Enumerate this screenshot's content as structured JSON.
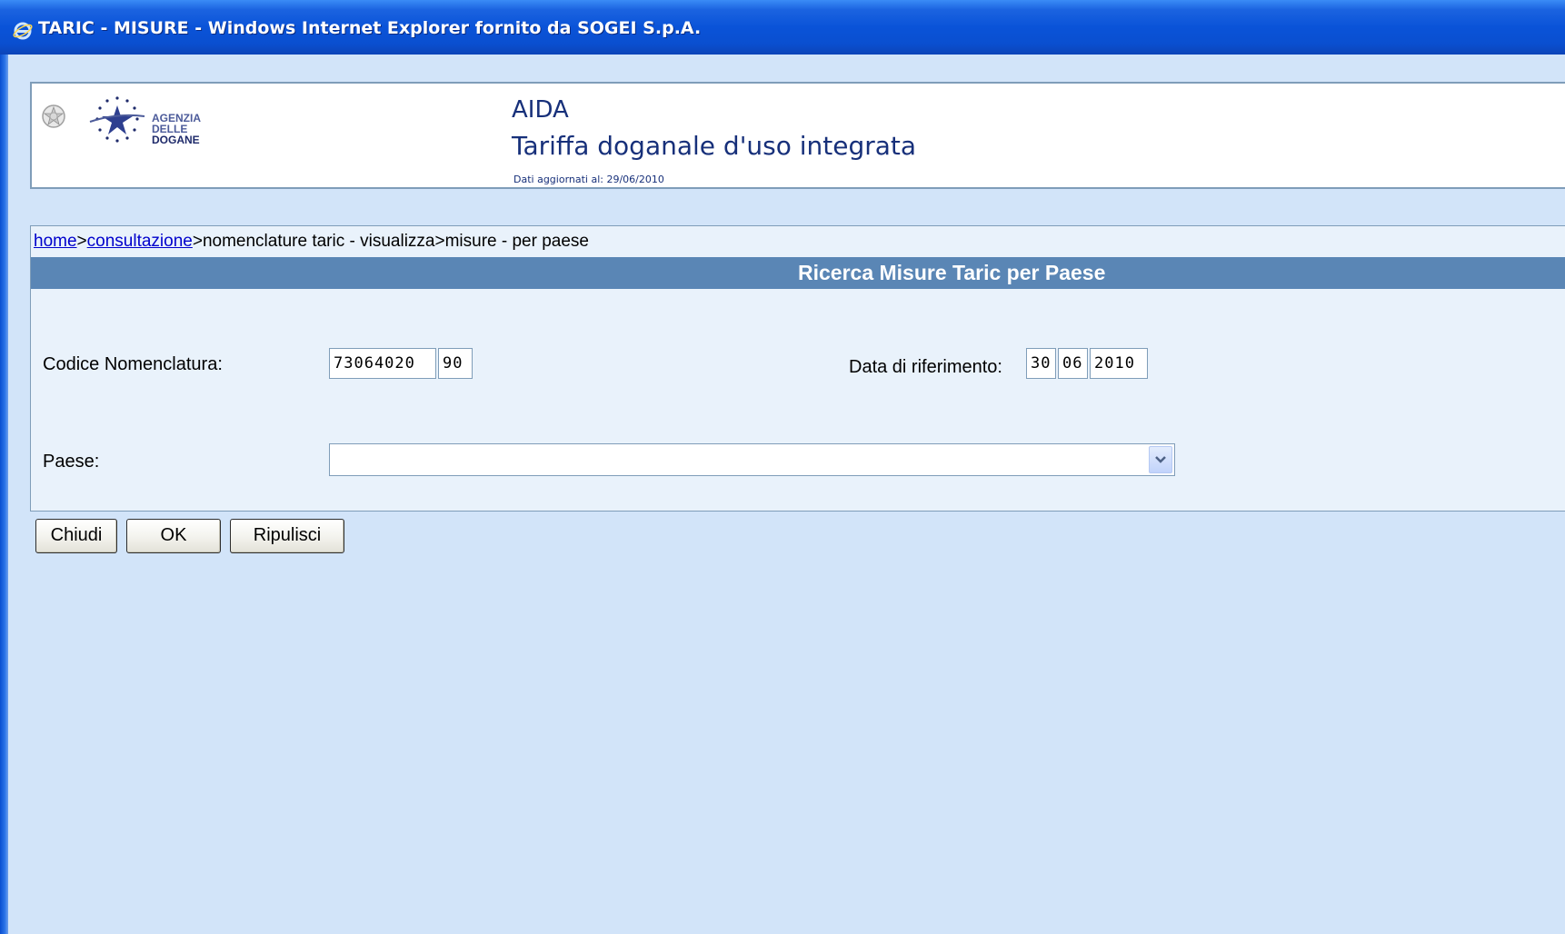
{
  "window": {
    "title": "TARIC - MISURE - Windows Internet Explorer fornito da SOGEI S.p.A."
  },
  "header": {
    "logo_text": [
      "AGENZIA",
      "DELLE",
      "DOGANE"
    ],
    "app_name": "AIDA",
    "app_subtitle": "Tariffa doganale d'uso integrata",
    "updated": "Dati aggiornati al: 29/06/2010"
  },
  "breadcrumb": {
    "home": "home",
    "sep1": ">",
    "consultazione": "consultazione",
    "rest": ">nomenclature taric - visualizza>misure - per paese"
  },
  "section": {
    "title": "Ricerca Misure Taric per Paese"
  },
  "form": {
    "codice_label": "Codice Nomenclatura:",
    "codice_value_1": "73064020",
    "codice_value_2": "90",
    "data_label": "Data di riferimento:",
    "data_day": "30",
    "data_month": "06",
    "data_year": "2010",
    "paese_label": "Paese:",
    "paese_value": ""
  },
  "buttons": {
    "chiudi": "Chiudi",
    "ok": "OK",
    "ripulisci": "Ripulisci"
  },
  "colors": {
    "titlebar": "#0a53d8",
    "background": "#d2e4f9",
    "section_header": "#5a86b5",
    "header_text": "#17307a",
    "link": "#0000cc"
  }
}
